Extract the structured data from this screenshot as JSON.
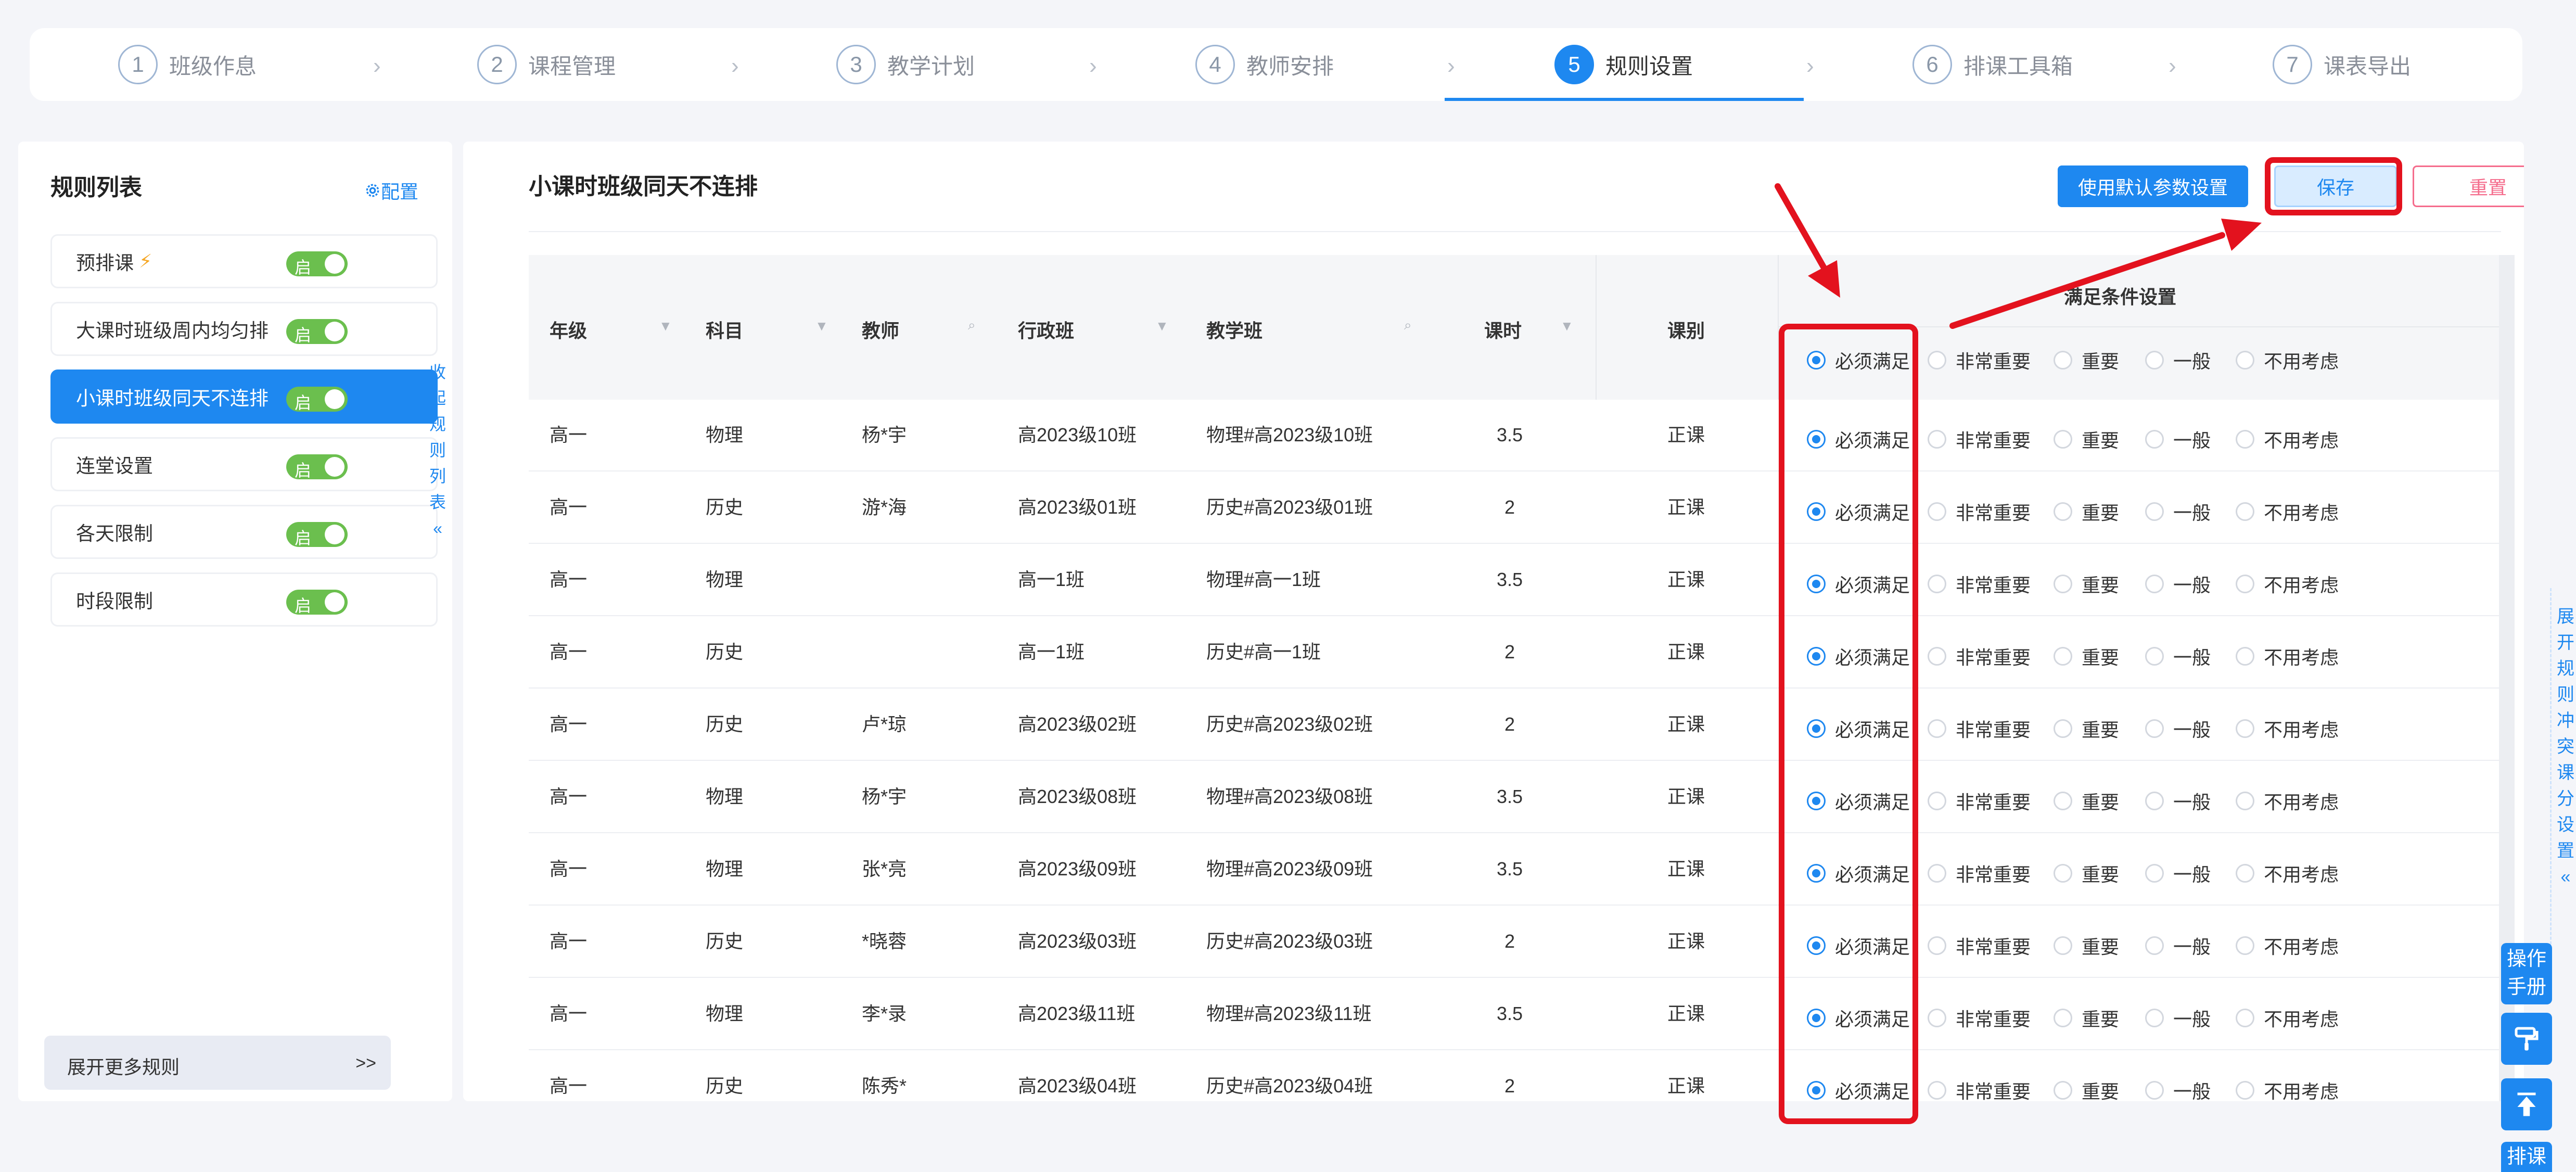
{
  "steps": [
    {
      "num": "1",
      "label": "班级作息"
    },
    {
      "num": "2",
      "label": "课程管理"
    },
    {
      "num": "3",
      "label": "教学计划"
    },
    {
      "num": "4",
      "label": "教师安排"
    },
    {
      "num": "5",
      "label": "规则设置"
    },
    {
      "num": "6",
      "label": "排课工具箱"
    },
    {
      "num": "7",
      "label": "课表导出"
    }
  ],
  "sidebar": {
    "title": "规则列表",
    "config": "配置",
    "toggle_label": "启",
    "rules": [
      "预排课",
      "大课时班级周内均匀排",
      "小课时班级同天不连排",
      "连堂设置",
      "各天限制",
      "时段限制"
    ],
    "more": "展开更多规则",
    "more_arrow": ">>",
    "collapse": [
      "收",
      "起",
      "规",
      "则",
      "列",
      "表",
      "«"
    ]
  },
  "main": {
    "title": "小课时班级同天不连排",
    "btn_default": "使用默认参数设置",
    "btn_save": "保存",
    "btn_reset": "重置"
  },
  "table": {
    "headers": {
      "grade": "年级",
      "subject": "科目",
      "teacher": "教师",
      "admin_class": "行政班",
      "teaching_class": "教学班",
      "hours": "课时",
      "type": "课别",
      "condition": "满足条件设置"
    },
    "options": [
      "必须满足",
      "非常重要",
      "重要",
      "一般",
      "不用考虑"
    ],
    "rows": [
      [
        "高一",
        "物理",
        "杨*宇",
        "高2023级10班",
        "物理#高2023级10班",
        "3.5",
        "正课"
      ],
      [
        "高一",
        "历史",
        "游*海",
        "高2023级01班",
        "历史#高2023级01班",
        "2",
        "正课"
      ],
      [
        "高一",
        "物理",
        "",
        "高一1班",
        "物理#高一1班",
        "3.5",
        "正课"
      ],
      [
        "高一",
        "历史",
        "",
        "高一1班",
        "历史#高一1班",
        "2",
        "正课"
      ],
      [
        "高一",
        "历史",
        "卢*琼",
        "高2023级02班",
        "历史#高2023级02班",
        "2",
        "正课"
      ],
      [
        "高一",
        "物理",
        "杨*宇",
        "高2023级08班",
        "物理#高2023级08班",
        "3.5",
        "正课"
      ],
      [
        "高一",
        "物理",
        "张*亮",
        "高2023级09班",
        "物理#高2023级09班",
        "3.5",
        "正课"
      ],
      [
        "高一",
        "历史",
        "*晓蓉",
        "高2023级03班",
        "历史#高2023级03班",
        "2",
        "正课"
      ],
      [
        "高一",
        "物理",
        "李*录",
        "高2023级11班",
        "物理#高2023级11班",
        "3.5",
        "正课"
      ],
      [
        "高一",
        "历史",
        "陈秀*",
        "高2023级04班",
        "历史#高2023级04班",
        "2",
        "正课"
      ]
    ]
  },
  "right": {
    "vertical": [
      "展",
      "开",
      "规",
      "则",
      "冲",
      "突",
      "课",
      "分",
      "设",
      "置",
      "«"
    ],
    "manual": "操作手册",
    "schedule": "排课"
  },
  "colors": {
    "primary": "#1e88f0",
    "toggle": "#6bbf4e",
    "annotation": "#e3121e",
    "reset": "#f56c8c"
  }
}
